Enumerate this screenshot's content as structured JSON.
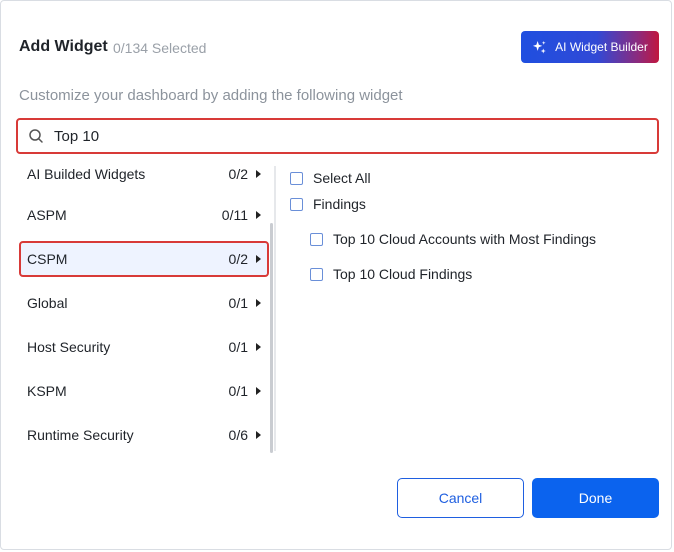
{
  "header": {
    "title": "Add Widget",
    "selected_count": "0/134 Selected",
    "ai_button_label": "AI Widget Builder"
  },
  "subtitle": "Customize your dashboard by adding the following widget",
  "search": {
    "value": "Top 10",
    "placeholder": ""
  },
  "categories": [
    {
      "name": "AI Builded Widgets",
      "count": "0/2"
    },
    {
      "name": "ASPM",
      "count": "0/11"
    },
    {
      "name": "CSPM",
      "count": "0/2",
      "active": true
    },
    {
      "name": "Global",
      "count": "0/1"
    },
    {
      "name": "Host Security",
      "count": "0/1"
    },
    {
      "name": "KSPM",
      "count": "0/1"
    },
    {
      "name": "Runtime Security",
      "count": "0/6"
    }
  ],
  "widgets": {
    "select_all": "Select All",
    "group": "Findings",
    "items": [
      "Top 10 Cloud Accounts with Most Findings",
      "Top 10 Cloud Findings"
    ]
  },
  "footer": {
    "cancel_label": "Cancel",
    "done_label": "Done"
  },
  "colors": {
    "primary": "#0b63ee",
    "highlight": "#d83a38",
    "checkbox": "#6a8fd8"
  }
}
